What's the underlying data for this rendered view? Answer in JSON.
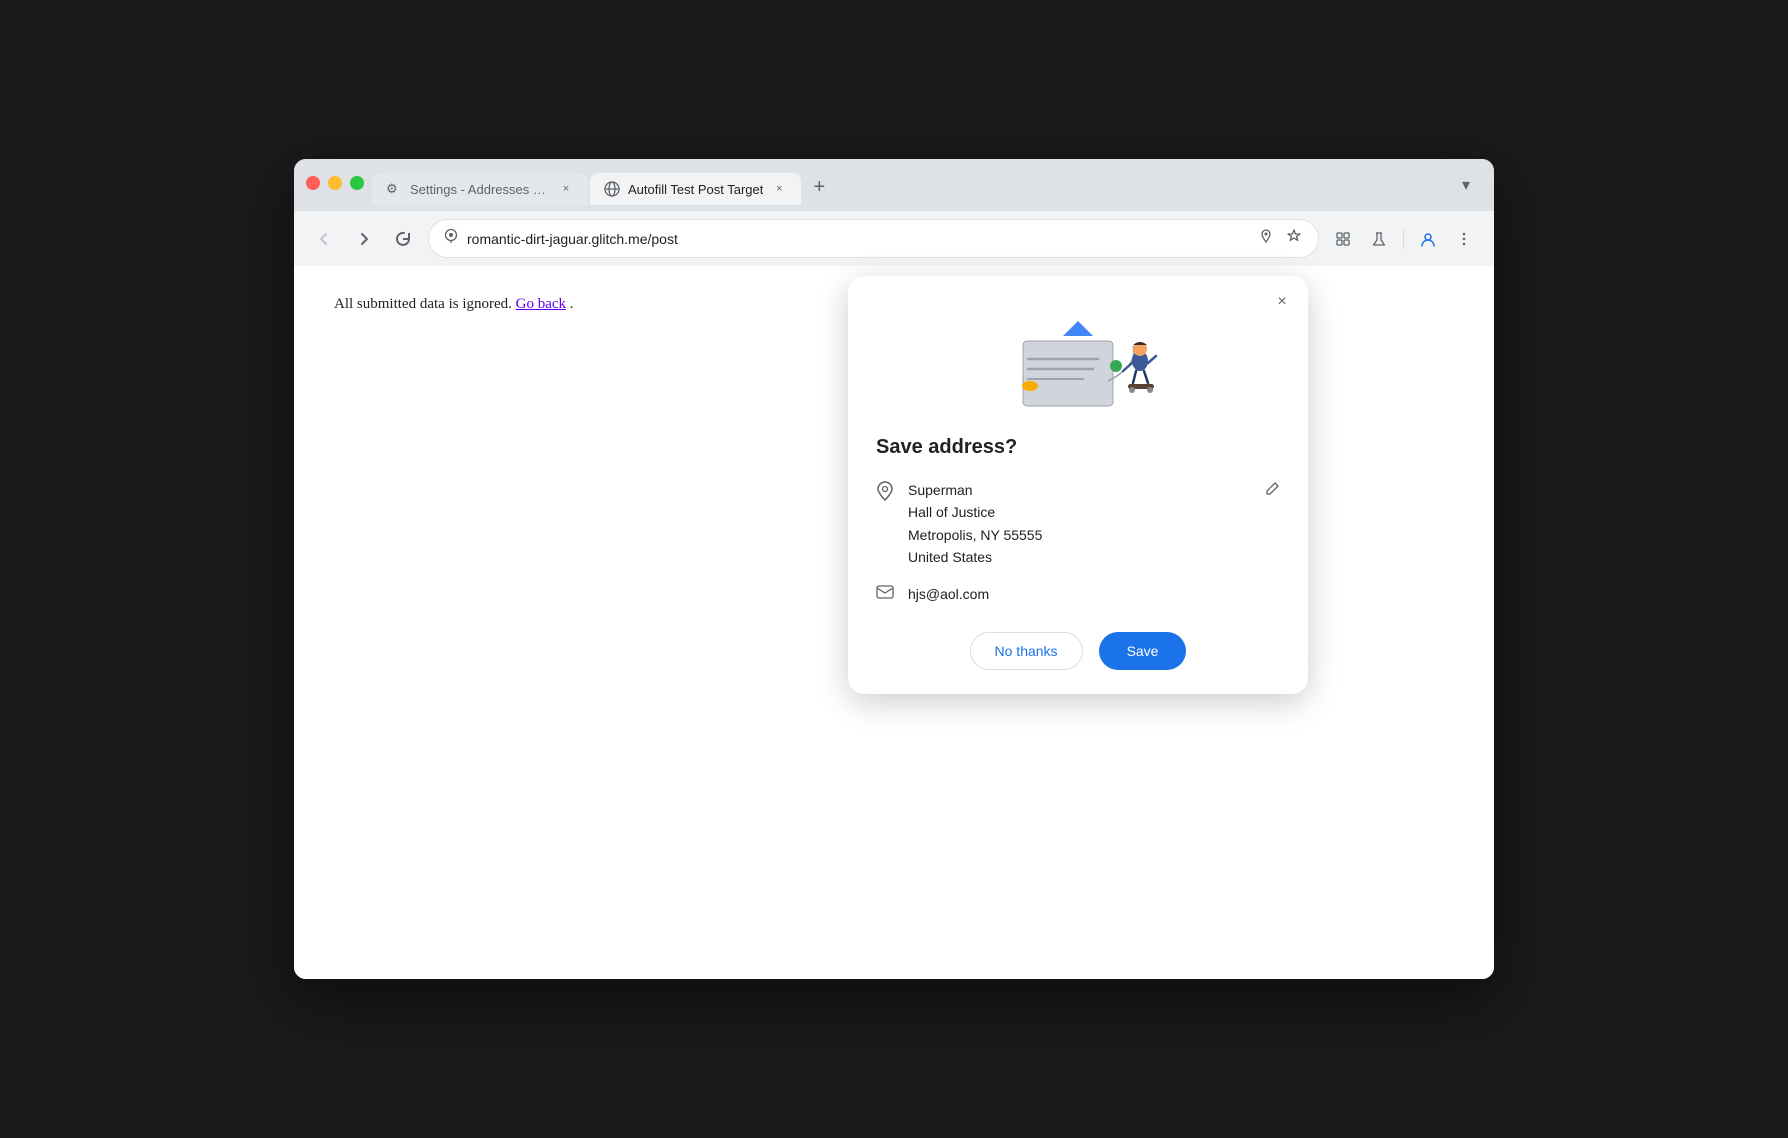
{
  "browser": {
    "tabs": [
      {
        "id": "tab-settings",
        "title": "Settings - Addresses and mo",
        "icon": "gear",
        "active": false
      },
      {
        "id": "tab-autofill",
        "title": "Autofill Test Post Target",
        "icon": "globe",
        "active": true
      }
    ],
    "url": "romantic-dirt-jaguar.glitch.me/post",
    "new_tab_label": "+",
    "dropdown_label": "▼"
  },
  "nav": {
    "back_label": "←",
    "forward_label": "→",
    "refresh_label": "↻"
  },
  "page": {
    "content": "All submitted data is ignored.",
    "link_text": "Go back",
    "period": "."
  },
  "dialog": {
    "title": "Save address?",
    "close_label": "×",
    "address": {
      "name": "Superman",
      "line1": "Hall of Justice",
      "line2": "Metropolis, NY 55555",
      "country": "United States"
    },
    "email": "hjs@aol.com",
    "actions": {
      "no_thanks": "No thanks",
      "save": "Save"
    }
  },
  "icons": {
    "gear": "⚙",
    "globe": "🌐",
    "location_pin": "📍",
    "email": "✉",
    "edit": "✏",
    "close": "×",
    "back": "←",
    "forward": "→",
    "refresh": "↻",
    "star": "☆",
    "puzzle": "🧩",
    "flask": "🧪",
    "person": "👤",
    "more": "⋮",
    "chevron_down": "⌄"
  }
}
